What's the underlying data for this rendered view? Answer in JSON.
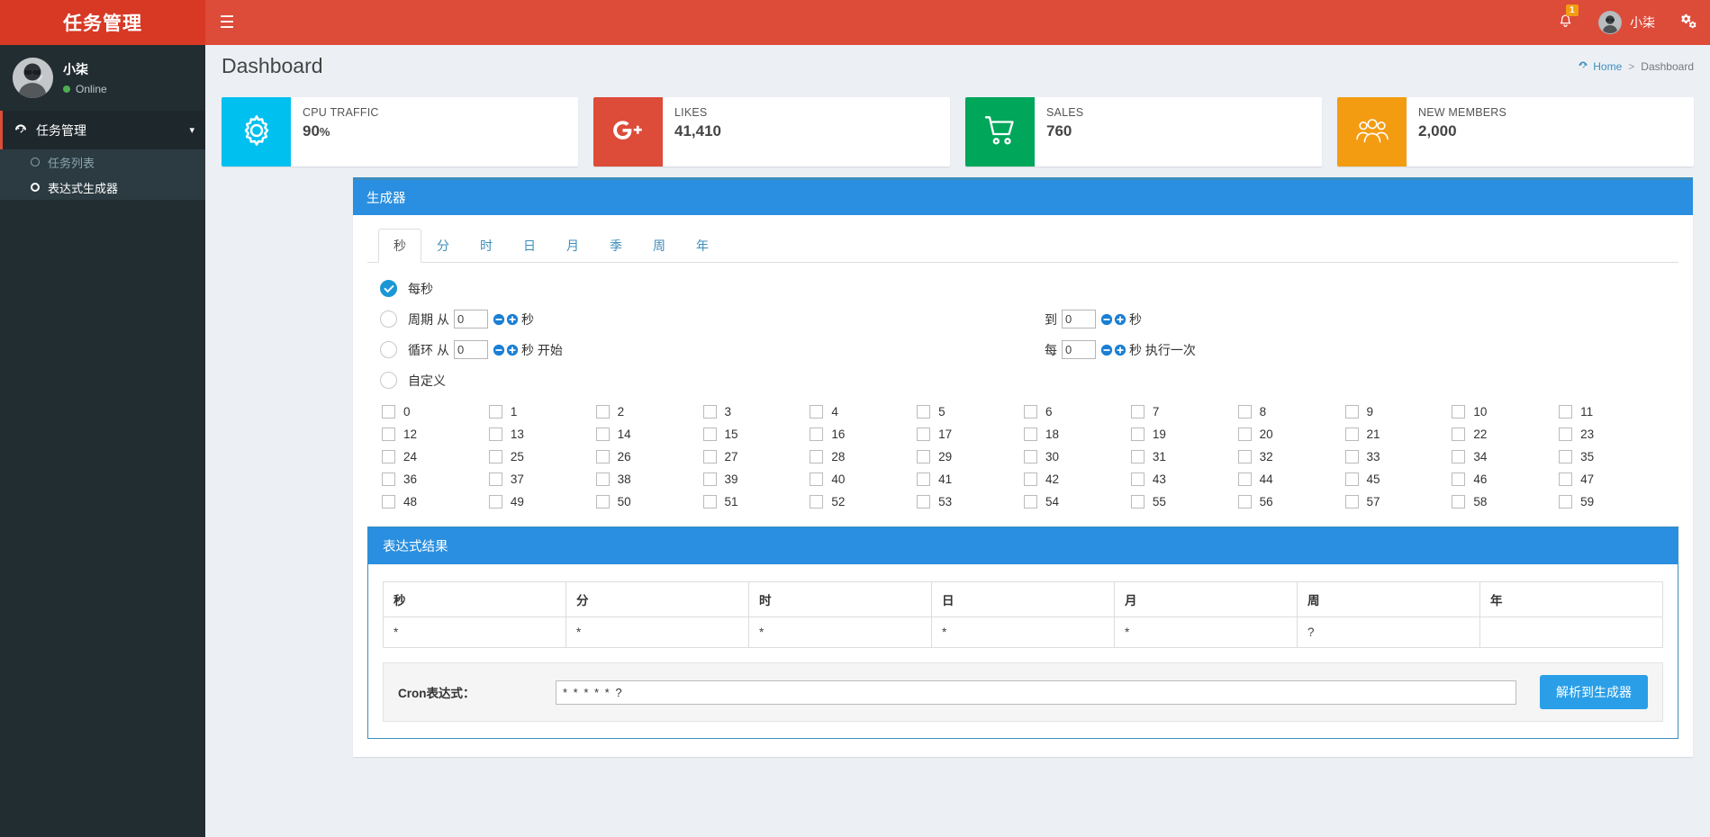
{
  "topbar": {
    "logo": "任务管理",
    "toggle_icon": "hamburger-icon",
    "notifications_count": "1",
    "user_name": "小柒",
    "settings_icon": "gear-cogs-icon"
  },
  "sidebar": {
    "user": {
      "name": "小柒",
      "status": "Online"
    },
    "menu": {
      "parent_label": "任务管理",
      "items": [
        {
          "label": "任务列表",
          "active": false
        },
        {
          "label": "表达式生成器",
          "active": true
        }
      ]
    }
  },
  "content": {
    "page_title": "Dashboard",
    "breadcrumb": {
      "home": "Home",
      "separator": ">",
      "current": "Dashboard"
    }
  },
  "infoboxes": [
    {
      "text": "CPU TRAFFIC",
      "number": "90",
      "suffix": "%",
      "color": "#00c0ef",
      "icon": "gear-icon"
    },
    {
      "text": "LIKES",
      "number": "41,410",
      "suffix": "",
      "color": "#dd4b39",
      "icon": "google-plus-icon"
    },
    {
      "text": "SALES",
      "number": "760",
      "suffix": "",
      "color": "#00a65a",
      "icon": "shopping-cart-icon"
    },
    {
      "text": "NEW MEMBERS",
      "number": "2,000",
      "suffix": "",
      "color": "#f39c12",
      "icon": "users-icon"
    }
  ],
  "generator": {
    "title": "生成器",
    "tabs": [
      {
        "label": "秒",
        "active": true
      },
      {
        "label": "分",
        "active": false
      },
      {
        "label": "时",
        "active": false
      },
      {
        "label": "日",
        "active": false
      },
      {
        "label": "月",
        "active": false
      },
      {
        "label": "季",
        "active": false
      },
      {
        "label": "周",
        "active": false
      },
      {
        "label": "年",
        "active": false
      }
    ],
    "options": {
      "every": {
        "label": "每秒",
        "selected": true
      },
      "range": {
        "label": "周期",
        "from_label": "从",
        "from_value": "0",
        "unit1": "秒",
        "to_label": "到",
        "to_value": "0",
        "unit2": "秒",
        "selected": false
      },
      "loop": {
        "label": "循环",
        "from_label": "从",
        "from_value": "0",
        "unit1": "秒 开始",
        "every_label": "每",
        "every_value": "0",
        "unit2": "秒 执行一次",
        "selected": false
      },
      "custom": {
        "label": "自定义",
        "selected": false
      }
    },
    "checkboxes": [
      "0",
      "1",
      "2",
      "3",
      "4",
      "5",
      "6",
      "7",
      "8",
      "9",
      "10",
      "11",
      "12",
      "13",
      "14",
      "15",
      "16",
      "17",
      "18",
      "19",
      "20",
      "21",
      "22",
      "23",
      "24",
      "25",
      "26",
      "27",
      "28",
      "29",
      "30",
      "31",
      "32",
      "33",
      "34",
      "35",
      "36",
      "37",
      "38",
      "39",
      "40",
      "41",
      "42",
      "43",
      "44",
      "45",
      "46",
      "47",
      "48",
      "49",
      "50",
      "51",
      "52",
      "53",
      "54",
      "55",
      "56",
      "57",
      "58",
      "59"
    ]
  },
  "result": {
    "title": "表达式结果",
    "headers": [
      "秒",
      "分",
      "时",
      "日",
      "月",
      "周",
      "年"
    ],
    "values": [
      "*",
      "*",
      "*",
      "*",
      "*",
      "?",
      ""
    ],
    "cron_label": "Cron表达式：",
    "cron_value": "* * * * * ?",
    "parse_button": "解析到生成器"
  }
}
